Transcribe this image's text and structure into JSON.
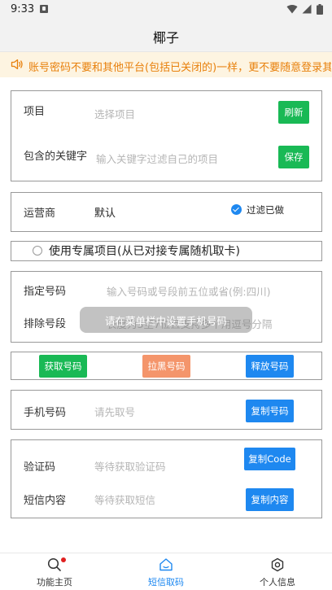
{
  "status_bar": {
    "time": "9:33"
  },
  "header": {
    "title": "椰子"
  },
  "notice": {
    "text": "账号密码不要和其他平台(包括已关闭的)一样，更不要随意登录其他平台"
  },
  "project_card": {
    "project_label": "项目",
    "project_placeholder": "选择项目",
    "refresh_button": "刷新",
    "keyword_label": "包含的关键字",
    "keyword_placeholder": "输入关键字过滤自己的项目",
    "save_button": "保存"
  },
  "operator_card": {
    "label": "运营商",
    "value": "默认",
    "filter_label": "过滤已做",
    "filter_checked": true
  },
  "exclusive_option": {
    "label": "使用专属项目(从已对接专属随机取卡)",
    "checked": false
  },
  "number_card": {
    "specified_label": "指定号码",
    "specified_placeholder": "输入号码或号段前五位或省(例:四川)",
    "exclude_label": "排除号段",
    "exclude_placeholder": "长度为3至7位且支持多个用逗号分隔"
  },
  "toast": {
    "text": "请在菜单栏中设置手机号码"
  },
  "actions": {
    "get_number": "获取号码",
    "blacklist_number": "拉黑号码",
    "release_number": "释放号码"
  },
  "phone_card": {
    "label": "手机号码",
    "placeholder": "请先取号",
    "copy_button": "复制号码"
  },
  "sms_card": {
    "code_label": "验证码",
    "code_placeholder": "等待获取验证码",
    "copy_code_button": "复制Code",
    "content_label": "短信内容",
    "content_placeholder": "等待获取短信",
    "copy_content_button": "复制内容"
  },
  "bottom_nav": {
    "items": [
      {
        "label": "功能主页",
        "icon": "search-icon",
        "badge": true
      },
      {
        "label": "短信取码",
        "icon": "home-icon",
        "active": true
      },
      {
        "label": "个人信息",
        "icon": "gear-icon"
      }
    ]
  },
  "colors": {
    "accent": "#1e88f0",
    "green": "#19b955",
    "warning": "#e8800c",
    "salmon": "#f4956b"
  }
}
